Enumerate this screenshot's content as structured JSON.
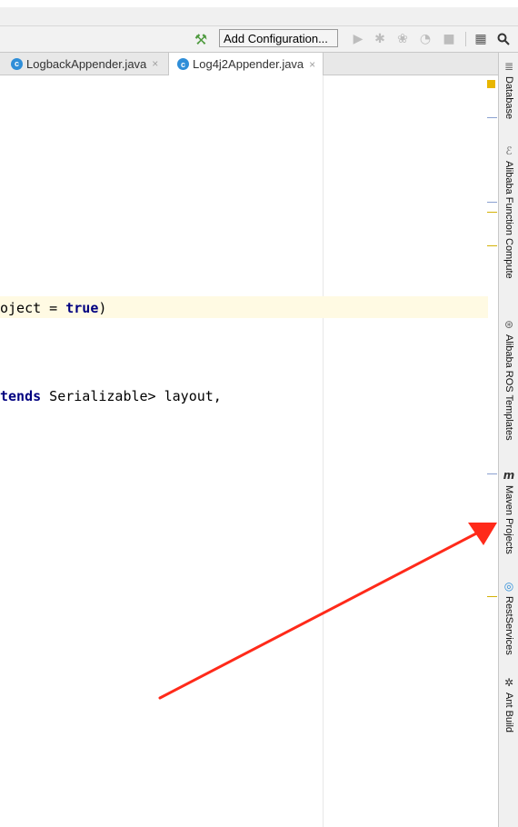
{
  "toolbar": {
    "run_config_label": "Add Configuration..."
  },
  "tabs": [
    {
      "label": "LogbackAppender.java",
      "icon": "java-class-icon",
      "close": "×",
      "active": false
    },
    {
      "label": "Log4j2Appender.java",
      "icon": "java-class-icon",
      "close": "×",
      "active": true
    }
  ],
  "editor": {
    "line1": {
      "prefix": "oject = ",
      "keyword": "true",
      "suffix": ")"
    },
    "line2": {
      "keyword": "tends",
      "rest": " Serializable> layout,"
    }
  },
  "right_tools": [
    {
      "label": "Database",
      "icon": "database-icon"
    },
    {
      "label": "Alibaba Function Compute",
      "icon": "function-compute-icon"
    },
    {
      "label": "Alibaba ROS Templates",
      "icon": "ros-templates-icon"
    },
    {
      "label": "Maven Projects",
      "icon": "maven-icon"
    },
    {
      "label": "RestServices",
      "icon": "rest-services-icon"
    },
    {
      "label": "Ant Build",
      "icon": "ant-icon"
    }
  ],
  "colors": {
    "annotation_arrow": "#ff2a1a",
    "keyword": "#000080",
    "current_line": "#fffae3"
  }
}
